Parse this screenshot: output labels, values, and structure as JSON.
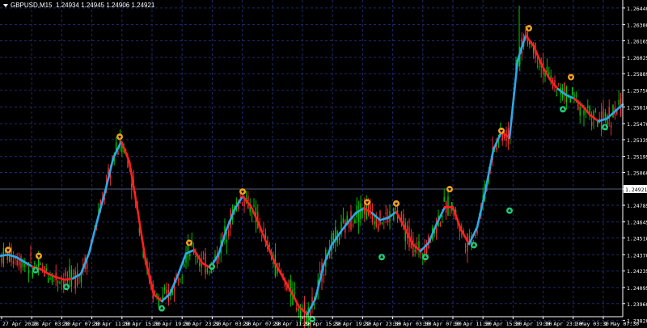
{
  "header": {
    "symbol_timeframe": "GBPUSD,M15",
    "ohlc": "1.24934 1.24945 1.24906 1.24921"
  },
  "colors": {
    "background": "#000000",
    "grid": "#1e2a6e",
    "axis_text": "#ffffff",
    "candle_up": "#00cc00",
    "candle_down": "#ff3333",
    "ma_up": "#2aa9e8",
    "ma_down": "#ff2020",
    "arrow_sell": "#f0a020",
    "arrow_buy": "#22c87a",
    "current_price_box": "#ffffff"
  },
  "chart_data": {
    "type": "candlestick_with_ma",
    "ylim": [
      1.2385,
      1.2648
    ],
    "y_ticks": [
      "1.26440",
      "1.26300",
      "1.26165",
      "1.26025",
      "1.25889",
      "1.25750",
      "1.25610",
      "1.25470",
      "1.25335",
      "1.25195",
      "1.25060",
      "1.24921",
      "1.24785",
      "1.24645",
      "1.24510",
      "1.24370",
      "1.24235",
      "1.24095",
      "1.23960",
      "1.23820"
    ],
    "current_price": "1.24921",
    "x_ticks": [
      "27 Apr 2020",
      "28 Apr 03:30",
      "28 Apr 07:30",
      "28 Apr 11:30",
      "28 Apr 15:30",
      "28 Apr 19:30",
      "28 Apr 23:30",
      "29 Apr 03:30",
      "29 Apr 07:30",
      "29 Apr 11:30",
      "29 Apr 15:30",
      "29 Apr 19:30",
      "29 Apr 23:30",
      "30 Apr 03:30",
      "30 Apr 07:30",
      "30 Apr 11:30",
      "30 Apr 15:30",
      "30 Apr 19:30",
      "30 Apr 23:30",
      "1 May 03:30",
      "1 May 07:30"
    ],
    "ma_series": {
      "points": [
        [
          0,
          1.2436
        ],
        [
          10,
          1.2437
        ],
        [
          20,
          1.2435
        ],
        [
          30,
          1.2431
        ],
        [
          40,
          1.2427
        ],
        [
          50,
          1.2425
        ],
        [
          60,
          1.2421
        ],
        [
          70,
          1.2418
        ],
        [
          80,
          1.2416
        ],
        [
          90,
          1.2417
        ],
        [
          100,
          1.2421
        ],
        [
          110,
          1.2438
        ],
        [
          120,
          1.2465
        ],
        [
          130,
          1.249
        ],
        [
          140,
          1.2518
        ],
        [
          150,
          1.2532
        ],
        [
          160,
          1.2515
        ],
        [
          170,
          1.2475
        ],
        [
          180,
          1.2432
        ],
        [
          190,
          1.2404
        ],
        [
          200,
          1.2398
        ],
        [
          210,
          1.2404
        ],
        [
          220,
          1.242
        ],
        [
          230,
          1.2438
        ],
        [
          240,
          1.2441
        ],
        [
          250,
          1.243
        ],
        [
          260,
          1.2426
        ],
        [
          270,
          1.2437
        ],
        [
          280,
          1.2458
        ],
        [
          290,
          1.2475
        ],
        [
          300,
          1.2486
        ],
        [
          310,
          1.2478
        ],
        [
          320,
          1.2463
        ],
        [
          330,
          1.2446
        ],
        [
          340,
          1.243
        ],
        [
          350,
          1.2418
        ],
        [
          360,
          1.2406
        ],
        [
          370,
          1.2393
        ],
        [
          380,
          1.2387
        ],
        [
          390,
          1.24
        ],
        [
          400,
          1.2428
        ],
        [
          410,
          1.2445
        ],
        [
          420,
          1.2455
        ],
        [
          430,
          1.2464
        ],
        [
          440,
          1.2472
        ],
        [
          450,
          1.2476
        ],
        [
          460,
          1.2472
        ],
        [
          470,
          1.2466
        ],
        [
          480,
          1.2468
        ],
        [
          490,
          1.2473
        ],
        [
          500,
          1.246
        ],
        [
          510,
          1.2446
        ],
        [
          520,
          1.244
        ],
        [
          530,
          1.2447
        ],
        [
          540,
          1.2463
        ],
        [
          550,
          1.2477
        ],
        [
          560,
          1.2477
        ],
        [
          570,
          1.2458
        ],
        [
          580,
          1.2446
        ],
        [
          590,
          1.246
        ],
        [
          600,
          1.249
        ],
        [
          610,
          1.2525
        ],
        [
          620,
          1.254
        ],
        [
          630,
          1.2535
        ],
        [
          640,
          1.26
        ],
        [
          650,
          1.2621
        ],
        [
          660,
          1.2612
        ],
        [
          670,
          1.2596
        ],
        [
          680,
          1.2584
        ],
        [
          690,
          1.2576
        ],
        [
          700,
          1.2571
        ],
        [
          710,
          1.2568
        ],
        [
          720,
          1.2562
        ],
        [
          730,
          1.2554
        ],
        [
          740,
          1.2549
        ],
        [
          750,
          1.2551
        ],
        [
          760,
          1.2557
        ],
        [
          770,
          1.2563
        ]
      ],
      "down_segments": [
        [
          40,
          90
        ],
        [
          150,
          200
        ],
        [
          240,
          260
        ],
        [
          300,
          380
        ],
        [
          450,
          460
        ],
        [
          490,
          520
        ],
        [
          550,
          580
        ],
        [
          620,
          630
        ],
        [
          650,
          690
        ],
        [
          710,
          740
        ]
      ]
    },
    "signals": [
      {
        "type": "sell",
        "x": 10,
        "y": 1.2441
      },
      {
        "type": "sell",
        "x": 48,
        "y": 1.2436
      },
      {
        "type": "buy",
        "x": 44,
        "y": 1.2424
      },
      {
        "type": "buy",
        "x": 82,
        "y": 1.241
      },
      {
        "type": "sell",
        "x": 148,
        "y": 1.2536
      },
      {
        "type": "buy",
        "x": 200,
        "y": 1.2392
      },
      {
        "type": "sell",
        "x": 234,
        "y": 1.2447
      },
      {
        "type": "buy",
        "x": 262,
        "y": 1.2427
      },
      {
        "type": "sell",
        "x": 300,
        "y": 1.249
      },
      {
        "type": "buy",
        "x": 386,
        "y": 1.2383
      },
      {
        "type": "sell",
        "x": 454,
        "y": 1.2481
      },
      {
        "type": "sell",
        "x": 490,
        "y": 1.248
      },
      {
        "type": "buy",
        "x": 472,
        "y": 1.2435
      },
      {
        "type": "buy",
        "x": 526,
        "y": 1.2435
      },
      {
        "type": "sell",
        "x": 556,
        "y": 1.2492
      },
      {
        "type": "buy",
        "x": 586,
        "y": 1.2445
      },
      {
        "type": "sell",
        "x": 620,
        "y": 1.2541
      },
      {
        "type": "buy",
        "x": 630,
        "y": 1.2474
      },
      {
        "type": "sell",
        "x": 654,
        "y": 1.2627
      },
      {
        "type": "sell",
        "x": 706,
        "y": 1.2586
      },
      {
        "type": "buy",
        "x": 696,
        "y": 1.2559
      },
      {
        "type": "buy",
        "x": 748,
        "y": 1.2544
      }
    ]
  }
}
